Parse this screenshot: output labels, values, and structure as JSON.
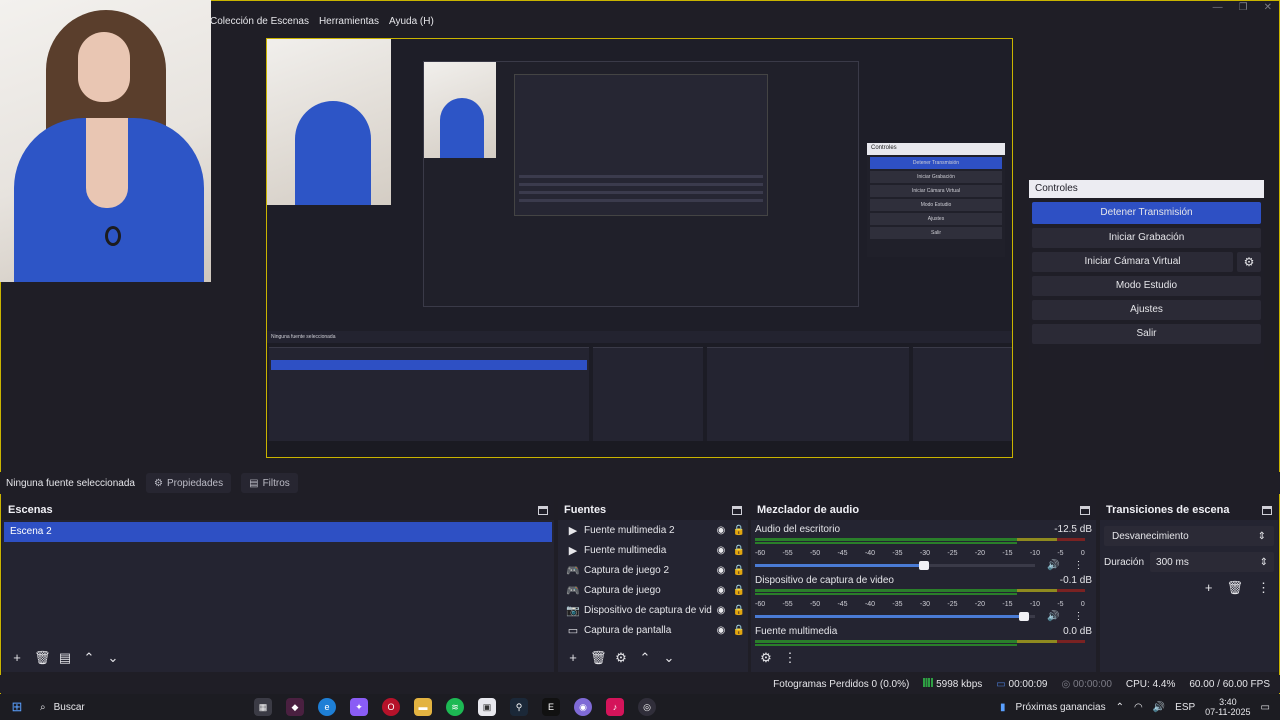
{
  "menu": [
    "Colección de Escenas",
    "Herramientas",
    "Ayuda (H)"
  ],
  "source_bar": {
    "no_selection": "Ninguna fuente seleccionada",
    "properties": "Propiedades",
    "filters": "Filtros"
  },
  "scenes": {
    "title": "Escenas",
    "items": [
      "Escena 2"
    ]
  },
  "sources": {
    "title": "Fuentes",
    "items": [
      {
        "name": "Fuente multimedia 2",
        "icon": "play-icon"
      },
      {
        "name": "Fuente multimedia",
        "icon": "play-icon"
      },
      {
        "name": "Captura de juego 2",
        "icon": "gamepad-icon"
      },
      {
        "name": "Captura de juego",
        "icon": "gamepad-icon"
      },
      {
        "name": "Dispositivo de captura de video",
        "icon": "camera-icon"
      },
      {
        "name": "Captura de pantalla",
        "icon": "monitor-icon"
      }
    ]
  },
  "mixer": {
    "title": "Mezclador de audio",
    "ticks": [
      "-60",
      "-55",
      "-50",
      "-45",
      "-40",
      "-35",
      "-30",
      "-25",
      "-20",
      "-15",
      "-10",
      "-5",
      "0"
    ],
    "channels": [
      {
        "name": "Audio del escritorio",
        "db": "-12.5 dB",
        "level": 0.62
      },
      {
        "name": "Dispositivo de captura de video",
        "db": "-0.1 dB",
        "level": 0.98
      },
      {
        "name": "Fuente multimedia",
        "db": "0.0 dB",
        "level": 1.0
      }
    ]
  },
  "transitions": {
    "title": "Transiciones de escena",
    "selected": "Desvanecimiento",
    "duration_label": "Duración",
    "duration_value": "300 ms"
  },
  "controls": {
    "title": "Controles",
    "stop_stream": "Detener Transmisión",
    "start_recording": "Iniciar Grabación",
    "start_virtual_cam": "Iniciar Cámara Virtual",
    "studio_mode": "Modo Estudio",
    "settings": "Ajustes",
    "exit": "Salir"
  },
  "status": {
    "dropped": "Fotogramas Perdidos 0 (0.0%)",
    "bitrate": "5998 kbps",
    "stream_time": "00:00:09",
    "rec_time": "00:00:00",
    "cpu": "CPU: 4.4%",
    "fps": "60.00 / 60.00 FPS"
  },
  "taskbar": {
    "search": "Buscar",
    "news": "Próximas ganancias",
    "lang": "ESP",
    "time": "3:40",
    "date": "07-11-2025"
  },
  "colors": {
    "accent": "#2e50c4",
    "meter_green": "#2a7f2a",
    "meter_yellow": "#8f8a1f",
    "meter_red": "#7a2222"
  }
}
